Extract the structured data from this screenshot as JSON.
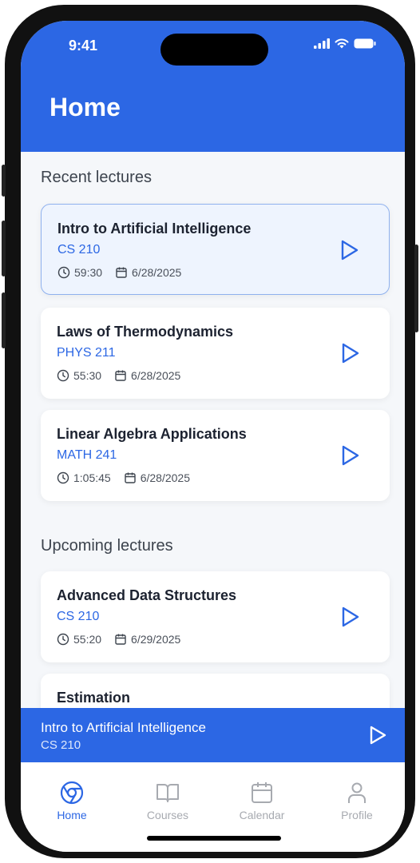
{
  "status_bar": {
    "time": "9:41"
  },
  "header": {
    "title": "Home"
  },
  "recent": {
    "heading": "Recent lectures",
    "items": [
      {
        "title": "Intro to Artificial Intelligence",
        "code": "CS 210",
        "duration": "59:30",
        "date": "6/28/2025"
      },
      {
        "title": "Laws of Thermodynamics",
        "code": "PHYS 211",
        "duration": "55:30",
        "date": "6/28/2025"
      },
      {
        "title": "Linear Algebra Applications",
        "code": "MATH 241",
        "duration": "1:05:45",
        "date": "6/28/2025"
      }
    ]
  },
  "upcoming": {
    "heading": "Upcoming lectures",
    "items": [
      {
        "title": "Advanced Data Structures",
        "code": "CS 210",
        "duration": "55:20",
        "date": "6/29/2025"
      },
      {
        "title": "Estimation"
      }
    ]
  },
  "now_playing": {
    "title": "Intro to Artificial Intelligence",
    "code": "CS 210"
  },
  "tabs": [
    {
      "label": "Home",
      "icon": "home-icon",
      "active": true
    },
    {
      "label": "Courses",
      "icon": "book-icon",
      "active": false
    },
    {
      "label": "Calendar",
      "icon": "calendar-icon",
      "active": false
    },
    {
      "label": "Profile",
      "icon": "profile-icon",
      "active": false
    }
  ],
  "colors": {
    "accent": "#2c67e4",
    "background": "#f5f7fa",
    "tab_inactive": "#a7aab0"
  }
}
